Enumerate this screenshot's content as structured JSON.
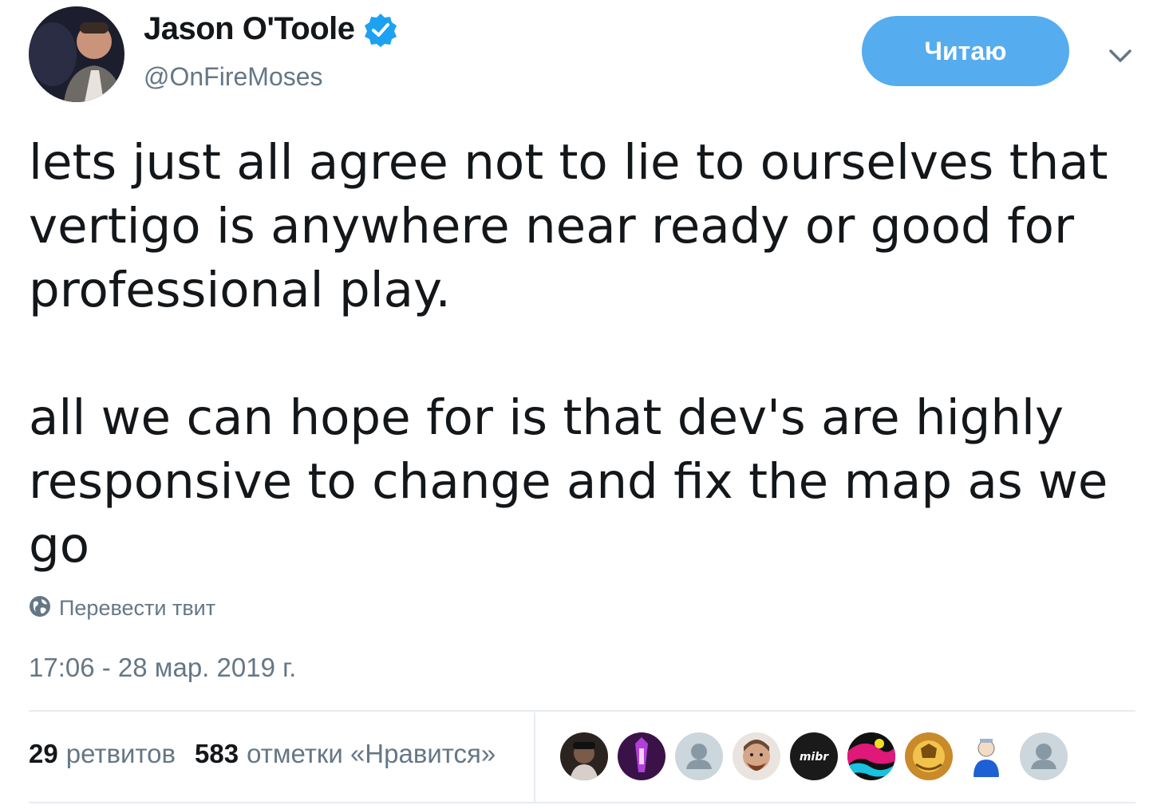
{
  "author": {
    "display_name": "Jason O'Toole",
    "handle": "@OnFireMoses",
    "verified": true
  },
  "follow_button": {
    "label": "Читаю"
  },
  "tweet": {
    "paragraphs": [
      "lets just all agree not to lie to ourselves that vertigo is anywhere near ready or good for professional play.",
      "all we can hope for is that dev's are highly responsive to change and fix the map as we go"
    ],
    "translate_label": "Перевести твит",
    "timestamp": "17:06 - 28 мар. 2019 г."
  },
  "stats": {
    "retweets": {
      "count": "29",
      "label": "ретвитов"
    },
    "likes": {
      "count": "583",
      "label": "отметки «Нравится»"
    }
  },
  "likers": [
    {
      "icon": "user-avatar-1"
    },
    {
      "icon": "user-avatar-2"
    },
    {
      "icon": "default-avatar-icon"
    },
    {
      "icon": "user-avatar-4"
    },
    {
      "icon": "mibr-logo",
      "text": "mibr"
    },
    {
      "icon": "user-avatar-6"
    },
    {
      "icon": "user-avatar-7"
    },
    {
      "icon": "user-avatar-8"
    },
    {
      "icon": "default-avatar-icon"
    }
  ],
  "colors": {
    "accent": "#55acee",
    "verified": "#1da1f2",
    "secondary_text": "#657786",
    "divider": "#e6ecf0"
  }
}
